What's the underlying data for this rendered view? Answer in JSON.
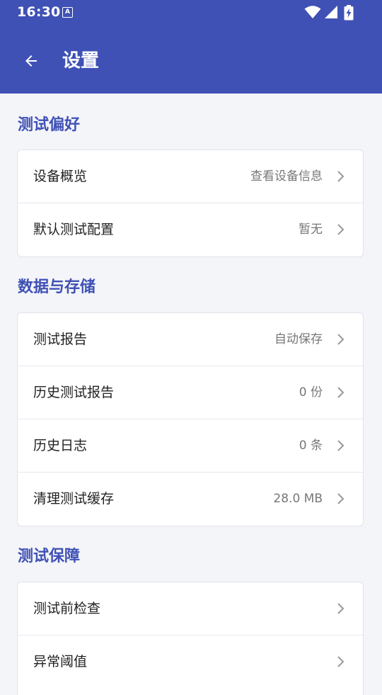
{
  "status_bar": {
    "time": "16:30",
    "notification_badge": "A",
    "icons": [
      "wifi-icon",
      "signal-icon",
      "battery-charging-icon"
    ]
  },
  "app_bar": {
    "title": "设置",
    "back_icon": "arrow-left-icon",
    "color": "#3f51b5"
  },
  "sections": [
    {
      "title": "测试偏好",
      "items": [
        {
          "label": "设备概览",
          "value": "查看设备信息"
        },
        {
          "label": "默认测试配置",
          "value": "暂无"
        }
      ]
    },
    {
      "title": "数据与存储",
      "items": [
        {
          "label": "测试报告",
          "value": "自动保存"
        },
        {
          "label": "历史测试报告",
          "value": "0 份"
        },
        {
          "label": "历史日志",
          "value": "0 条"
        },
        {
          "label": "清理测试缓存",
          "value": "28.0 MB"
        }
      ]
    },
    {
      "title": "测试保障",
      "items": [
        {
          "label": "测试前检查",
          "value": ""
        },
        {
          "label": "异常阈值",
          "value": ""
        }
      ]
    }
  ],
  "colors": {
    "accent": "#3f51b5",
    "background": "#f4f5f9",
    "card": "#ffffff"
  }
}
